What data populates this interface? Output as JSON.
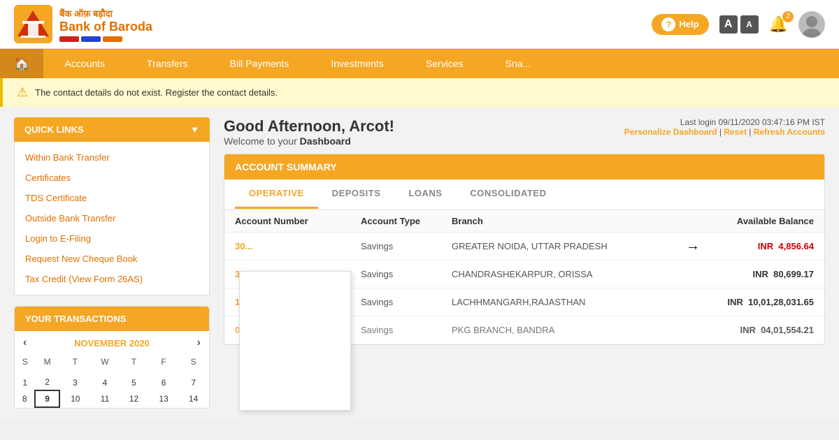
{
  "header": {
    "logo_hindi": "बैंक ऑफ़ बड़ौदा",
    "logo_english": "Bank of Baroda",
    "help_label": "Help",
    "font_large": "A",
    "font_small": "A",
    "bell_badge": "2"
  },
  "navbar": {
    "home_icon": "🏠",
    "items": [
      {
        "label": "Accounts",
        "id": "accounts"
      },
      {
        "label": "Transfers",
        "id": "transfers"
      },
      {
        "label": "Bill Payments",
        "id": "bill-payments"
      },
      {
        "label": "Investments",
        "id": "investments"
      },
      {
        "label": "Services",
        "id": "services"
      },
      {
        "label": "Sna...",
        "id": "more"
      }
    ]
  },
  "alert": {
    "message": "The contact details do not exist. Register the contact details."
  },
  "sidebar": {
    "quick_links_title": "QUICK LINKS",
    "links": [
      "Within Bank Transfer",
      "Certificates",
      "TDS Certificate",
      "Outside Bank Transfer",
      "Login to E-Filing",
      "Request New Cheque Book",
      "Tax Credit (View Form 26AS)"
    ],
    "transactions_title": "YOUR TRANSACTIONS",
    "calendar": {
      "month": "NOVEMBER 2020",
      "days_header": [
        "S",
        "M",
        "T",
        "W",
        "T",
        "F",
        "S"
      ],
      "weeks": [
        [
          null,
          null,
          null,
          null,
          null,
          null,
          null
        ],
        [
          "1",
          "2",
          "3",
          "4",
          "5",
          "6",
          "7"
        ],
        [
          "8",
          "9",
          "10",
          "11",
          "12",
          "13",
          "14"
        ]
      ],
      "today": "9"
    }
  },
  "dashboard": {
    "greeting": "Good Afternoon, Arcot!",
    "welcome": "Welcome to your ",
    "welcome_bold": "Dashboard",
    "last_login_label": "Last login 09/11/2020 03:47:16 PM IST",
    "personalize_label": "Personalize Dashboard",
    "reset_label": "Reset",
    "refresh_label": "Refresh Accounts",
    "account_summary_title": "ACCOUNT SUMMARY",
    "tabs": [
      {
        "label": "OPERATIVE",
        "active": true
      },
      {
        "label": "DEPOSITS",
        "active": false
      },
      {
        "label": "LOANS",
        "active": false
      },
      {
        "label": "CONSOLIDATED",
        "active": false
      }
    ],
    "table_headers": {
      "account_number": "Account Number",
      "account_type": "Account Type",
      "branch": "Branch",
      "balance": "Available Balance"
    },
    "accounts": [
      {
        "number": "30...",
        "type": "Savings",
        "branch": "GREATER NOIDA, UTTAR PRADESH",
        "balance": "INR  4,856.64",
        "highlight": true,
        "arrow": true
      },
      {
        "number": "32...",
        "type": "Savings",
        "branch": "CHANDRASHEKARPUR, ORISSA",
        "balance": "INR  80,699.17",
        "highlight": false,
        "arrow": false
      },
      {
        "number": "14...",
        "type": "Savings",
        "branch": "LACHHMANGARH,RAJASTHAN",
        "balance": "INR  10,01,28,031.65",
        "highlight": false,
        "arrow": false
      },
      {
        "number": "000...",
        "type": "Savings",
        "branch": "PKG BRANCH, BANDRA",
        "balance": "INR  04,01,554.21",
        "highlight": false,
        "arrow": false
      }
    ]
  }
}
